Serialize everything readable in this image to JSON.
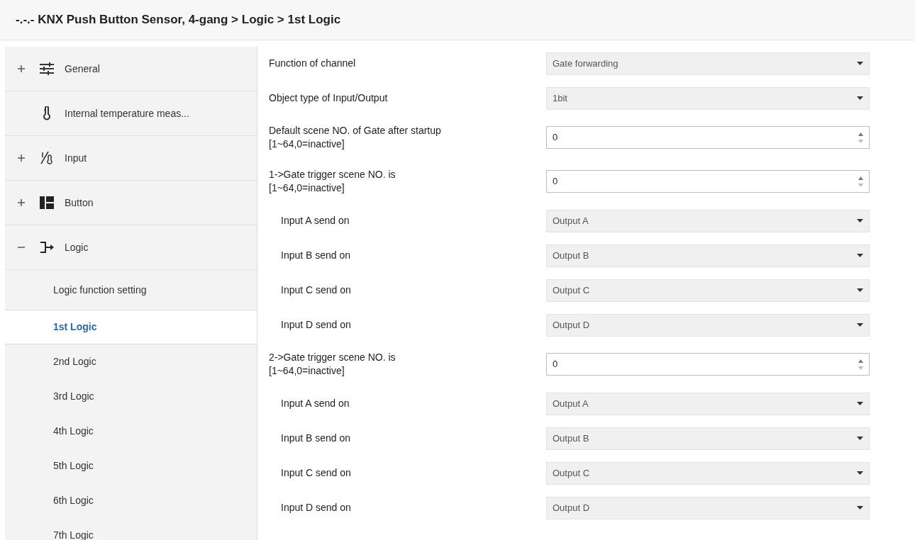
{
  "window": {
    "title": "-.-.- KNX Push Button Sensor, 4-gang > Logic > 1st Logic"
  },
  "sidebar": {
    "items": [
      {
        "label": "General",
        "kind": "branch",
        "expanded": false
      },
      {
        "label": "Internal temperature meas...",
        "kind": "leaf"
      },
      {
        "label": "Input",
        "kind": "branch",
        "expanded": false
      },
      {
        "label": "Button",
        "kind": "branch",
        "expanded": false
      },
      {
        "label": "Logic",
        "kind": "branch",
        "expanded": true
      }
    ],
    "children": [
      {
        "label": "Logic function setting",
        "selected": false
      },
      {
        "label": "1st Logic",
        "selected": true
      },
      {
        "label": "2nd Logic",
        "selected": false
      },
      {
        "label": "3rd Logic",
        "selected": false
      },
      {
        "label": "4th Logic",
        "selected": false
      },
      {
        "label": "5th Logic",
        "selected": false
      },
      {
        "label": "6th Logic",
        "selected": false
      },
      {
        "label": "7th Logic",
        "selected": false
      }
    ]
  },
  "parameters": [
    {
      "label": "Function of channel",
      "kind": "dropdown",
      "value": "Gate forwarding",
      "indented": false
    },
    {
      "label": "Object type of Input/Output",
      "kind": "dropdown",
      "value": "1bit",
      "indented": false
    },
    {
      "label": "Default scene NO. of Gate after startup\n[1~64,0=inactive]",
      "kind": "number",
      "value": "0",
      "indented": false
    },
    {
      "label": "1->Gate trigger scene NO. is\n[1~64,0=inactive]",
      "kind": "number",
      "value": "0",
      "indented": false
    },
    {
      "label": "Input A send on",
      "kind": "dropdown",
      "value": "Output A",
      "indented": true
    },
    {
      "label": "Input B send on",
      "kind": "dropdown",
      "value": "Output B",
      "indented": true
    },
    {
      "label": "Input C send on",
      "kind": "dropdown",
      "value": "Output C",
      "indented": true
    },
    {
      "label": "Input D send on",
      "kind": "dropdown",
      "value": "Output D",
      "indented": true
    },
    {
      "label": "2->Gate trigger scene NO. is\n[1~64,0=inactive]",
      "kind": "number",
      "value": "0",
      "indented": false
    },
    {
      "label": "Input A send on",
      "kind": "dropdown",
      "value": "Output A",
      "indented": true
    },
    {
      "label": "Input B send on",
      "kind": "dropdown",
      "value": "Output B",
      "indented": true
    },
    {
      "label": "Input C send on",
      "kind": "dropdown",
      "value": "Output C",
      "indented": true
    },
    {
      "label": "Input D send on",
      "kind": "dropdown",
      "value": "Output D",
      "indented": true
    }
  ]
}
